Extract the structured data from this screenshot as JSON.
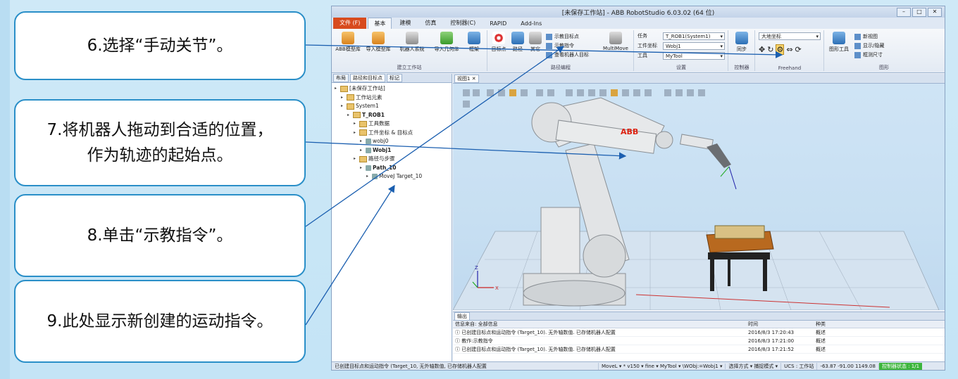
{
  "callouts": {
    "step6": "6.选择“手动关节”。",
    "step7_line1": "7.将机器人拖动到合适的位置，",
    "step7_line2": "作为轨迹的起始点。",
    "step8": "8.单击“示教指令”。",
    "step9": "9.此处显示新创建的运动指令。"
  },
  "app": {
    "title": "[未保存工作站] - ABB RobotStudio 6.03.02 (64 位)",
    "tabs": [
      "文件 (F)",
      "基本",
      "建模",
      "仿真",
      "控制器(C)",
      "RAPID",
      "Add-Ins"
    ],
    "ribbon": {
      "btn_abb_library": "ABB模型库",
      "btn_import_library": "导入模型库",
      "btn_robot_system": "机器人系统",
      "btn_import_geometry": "导入几何体",
      "btn_frame": "框架",
      "group_build": "建立工作站",
      "btn_target": "目标点",
      "btn_path": "路径",
      "btn_other": "其它",
      "btn_teach_target": "示教目标点",
      "btn_teach_instruction": "示教指令",
      "btn_view_robot_target": "查看机器人目标",
      "btn_multimove": "MultiMove",
      "group_path": "路径编程",
      "label_task": "任务",
      "label_wobj": "工件坐标",
      "label_tool": "工具",
      "val_task": "T_ROB1(System1)",
      "val_wobj": "Wobj1",
      "val_tool": "MyTool",
      "group_settings": "设置",
      "btn_sync": "同步",
      "group_controller": "控制器",
      "val_coord": "大地坐标",
      "group_freehand": "Freehand",
      "btn_graphics": "图形工具",
      "btn_new_view": "新视图",
      "btn_show_hide": "显示/隐藏",
      "btn_measure": "框测尺寸",
      "group_graphics": "图形"
    },
    "left_pane": {
      "tabs": [
        "布局",
        "路径和目标点",
        "标记"
      ],
      "tree": [
        {
          "indent": 0,
          "label": "[未保存工作站]",
          "bold": false
        },
        {
          "indent": 1,
          "label": "工作站元素",
          "bold": false
        },
        {
          "indent": 1,
          "label": "System1",
          "bold": false
        },
        {
          "indent": 2,
          "label": "T_ROB1",
          "bold": true
        },
        {
          "indent": 3,
          "label": "工具数据",
          "bold": false
        },
        {
          "indent": 3,
          "label": "工件坐标 & 目标点",
          "bold": false
        },
        {
          "indent": 4,
          "label": "wobj0",
          "bold": false
        },
        {
          "indent": 4,
          "label": "Wobj1",
          "bold": true
        },
        {
          "indent": 3,
          "label": "路径与步骤",
          "bold": false
        },
        {
          "indent": 4,
          "label": "Path_10",
          "bold": true
        },
        {
          "indent": 5,
          "label": "MoveJ Target_10",
          "bold": false
        }
      ]
    },
    "view_tab": "视图1",
    "robot_brand": "ABB",
    "output": {
      "tab": "输出",
      "filter": "信息来自: 全部信息",
      "col_time": "时间",
      "col_type": "种类",
      "rows": [
        {
          "msg": "已创建目标点和运动指令 (Target_10). 无外轴数值. 已存储机器人配置",
          "time": "2016/8/3 17:20:43",
          "type": "概述"
        },
        {
          "msg": "教作:示教指令",
          "time": "2016/8/3 17:21:00",
          "type": "概述"
        },
        {
          "msg": "已创建目标点和运动指令 (Target_10). 无外轴数值. 已存储机器人配置",
          "time": "2016/8/3 17:21:52",
          "type": "概述"
        }
      ]
    },
    "statusbar": {
      "msg": "已创建目标点和运动指令 (Target_10, 无外轴数值, 已存储机器人配置",
      "instr": "MoveL ▾ * v150 ▾ fine ▾ MyTool ▾ \\WObj:=Wobj1 ▾",
      "mode": "选择方式 ▾ 捕捉模式 ▾",
      "ucs": "UCS : 工作站",
      "coords": "-63.87 -91.00 1149.08",
      "ctrl": "控制器状态 : 1/1"
    }
  }
}
